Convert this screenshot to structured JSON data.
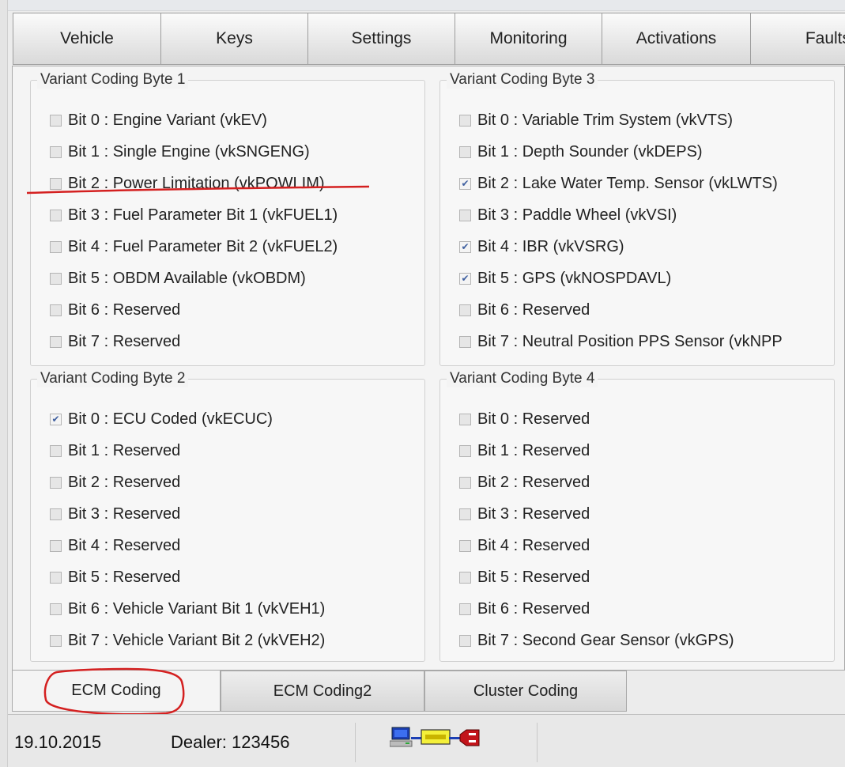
{
  "top_tabs": [
    "Vehicle",
    "Keys",
    "Settings",
    "Monitoring",
    "Activations",
    "Faults"
  ],
  "groups": {
    "byte1": {
      "title": "Variant Coding Byte 1",
      "bits": [
        {
          "label": "Bit 0 : Engine Variant (vkEV)",
          "checked": false
        },
        {
          "label": "Bit 1 : Single Engine (vkSNGENG)",
          "checked": false
        },
        {
          "label": "Bit 2 : Power Limitation (vkPOWLIM)",
          "checked": false
        },
        {
          "label": "Bit 3 : Fuel Parameter Bit 1 (vkFUEL1)",
          "checked": false
        },
        {
          "label": "Bit 4 : Fuel Parameter Bit 2 (vkFUEL2)",
          "checked": false
        },
        {
          "label": "Bit 5 : OBDM Available (vkOBDM)",
          "checked": false
        },
        {
          "label": "Bit 6 : Reserved",
          "checked": false
        },
        {
          "label": "Bit 7 : Reserved",
          "checked": false
        }
      ]
    },
    "byte2": {
      "title": "Variant Coding Byte 2",
      "bits": [
        {
          "label": "Bit 0 : ECU Coded (vkECUC)",
          "checked": true
        },
        {
          "label": "Bit 1 : Reserved",
          "checked": false
        },
        {
          "label": "Bit 2 : Reserved",
          "checked": false
        },
        {
          "label": "Bit 3 : Reserved",
          "checked": false
        },
        {
          "label": "Bit 4 : Reserved",
          "checked": false
        },
        {
          "label": "Bit 5 : Reserved",
          "checked": false
        },
        {
          "label": "Bit 6 : Vehicle Variant Bit 1 (vkVEH1)",
          "checked": false
        },
        {
          "label": "Bit 7 : Vehicle Variant Bit 2 (vkVEH2)",
          "checked": false
        }
      ]
    },
    "byte3": {
      "title": "Variant Coding Byte 3",
      "bits": [
        {
          "label": "Bit 0 : Variable Trim System (vkVTS)",
          "checked": false
        },
        {
          "label": "Bit 1 : Depth Sounder (vkDEPS)",
          "checked": false
        },
        {
          "label": "Bit 2 : Lake Water Temp. Sensor (vkLWTS)",
          "checked": true
        },
        {
          "label": "Bit 3 : Paddle Wheel (vkVSI)",
          "checked": false
        },
        {
          "label": "Bit 4 : IBR (vkVSRG)",
          "checked": true
        },
        {
          "label": "Bit 5 : GPS (vkNOSPDAVL)",
          "checked": true
        },
        {
          "label": "Bit 6 : Reserved",
          "checked": false
        },
        {
          "label": "Bit 7 : Neutral Position PPS Sensor (vkNPP",
          "checked": false
        }
      ]
    },
    "byte4": {
      "title": "Variant Coding Byte 4",
      "bits": [
        {
          "label": "Bit 0 : Reserved",
          "checked": false
        },
        {
          "label": "Bit 1 : Reserved",
          "checked": false
        },
        {
          "label": "Bit 2 : Reserved",
          "checked": false
        },
        {
          "label": "Bit 3 : Reserved",
          "checked": false
        },
        {
          "label": "Bit 4 : Reserved",
          "checked": false
        },
        {
          "label": "Bit 5 : Reserved",
          "checked": false
        },
        {
          "label": "Bit 6 : Reserved",
          "checked": false
        },
        {
          "label": "Bit 7 : Second Gear Sensor (vkGPS)",
          "checked": false
        }
      ]
    }
  },
  "bottom_tabs": [
    "ECM Coding",
    "ECM Coding2",
    "Cluster Coding"
  ],
  "active_bottom_tab": "ECM Coding",
  "status": {
    "date": "19.10.2015",
    "dealer": "Dealer: 123456"
  },
  "icons": {
    "connection": [
      "computer-icon",
      "interface-adapter-icon",
      "vehicle-plug-icon"
    ]
  },
  "colors": {
    "annotation": "#d42020",
    "checkbox_mark": "#4060a0"
  }
}
